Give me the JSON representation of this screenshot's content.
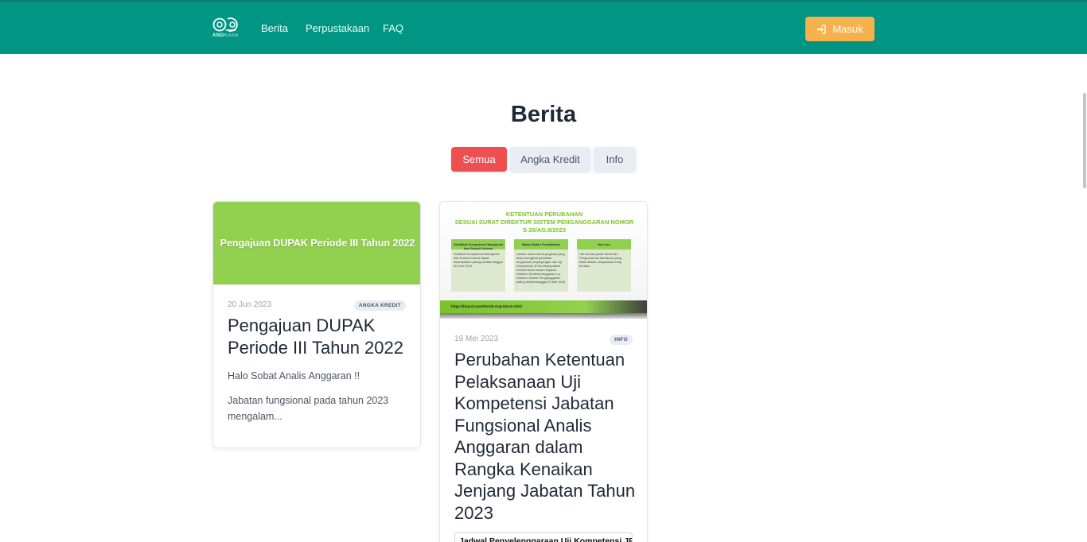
{
  "navbar": {
    "logo_text_bold": "ANG",
    "logo_text_thin": "KASA",
    "links": [
      "Berita",
      "Perpustakaan",
      "FAQ"
    ],
    "login_label": "Masuk",
    "login_icon": "sign-in-icon"
  },
  "page": {
    "title": "Berita"
  },
  "tabs": [
    {
      "label": "Semua",
      "active": true
    },
    {
      "label": "Angka Kredit",
      "active": false
    },
    {
      "label": "Info",
      "active": false
    }
  ],
  "cards": [
    {
      "thumbnail_text": "Pengajuan DUPAK Periode III Tahun 2022",
      "date": "20 Jun 2023",
      "badge": "ANGKA KREDIT",
      "title": "Pengajuan DUPAK Periode III Tahun 2022",
      "excerpt_1": "Halo Sobat Analis Anggaran !!",
      "excerpt_2": "Jabatan fungsional pada tahun 2023 mengalam..."
    },
    {
      "thumbnail": {
        "title_lines": [
          "KETENTUAN PERUBAHAN",
          "SESUAI SURAT DIREKTUR SISTEM PENGANGGARAN NOMOR",
          "S-26/AG.8/2023"
        ],
        "columns": [
          {
            "head": "Sertifikat Kompetensi Manajerial dan Sosial Kultural",
            "body": "Sertifikat Kompetensi Manajerial dan Sosial Kultural dapat disampaikan paling lambat tanggal 30 Juni 2023"
          },
          {
            "head": "Batas Waktu Pendaftaran",
            "body": "Usulan nama-nama pegawai yang akan mengikuti pelatihan fungsional penjenjangan dan Uji Kompetensi JFAA disampaikan melalui surat usulan kepada Direktur Jenderal Anggaran c.q. Direktur Sistem Penganggaran paling lambat tanggal 23 Mei 2023"
          },
          {
            "head": "Hal Lain",
            "body": "Hal-hal lain pada Surat dan Pengumuman dimaksud yang tidak diubah, dinyatakan tetap berlaku"
          }
        ],
        "link": "https://tinyurl.com/Perub-Ang-Ukom-2023"
      },
      "date": "19 Mei 2023",
      "badge": "INFO",
      "title": "Perubahan Ketentuan Pelaksanaan Uji Kompetensi Jabatan Fungsional Analis Anggaran dalam Rangka Kenaikan Jenjang Jabatan Tahun 2023",
      "table_text": "Jadwal Penyelenggaraan Uji Kompetensi JFAA"
    }
  ],
  "colors": {
    "navbar": "#009683",
    "login_button": "#f6b14f",
    "active_tab": "#ee4f53",
    "inactive_tab": "#e8ecf3",
    "card1_thumb": "#92d050"
  }
}
